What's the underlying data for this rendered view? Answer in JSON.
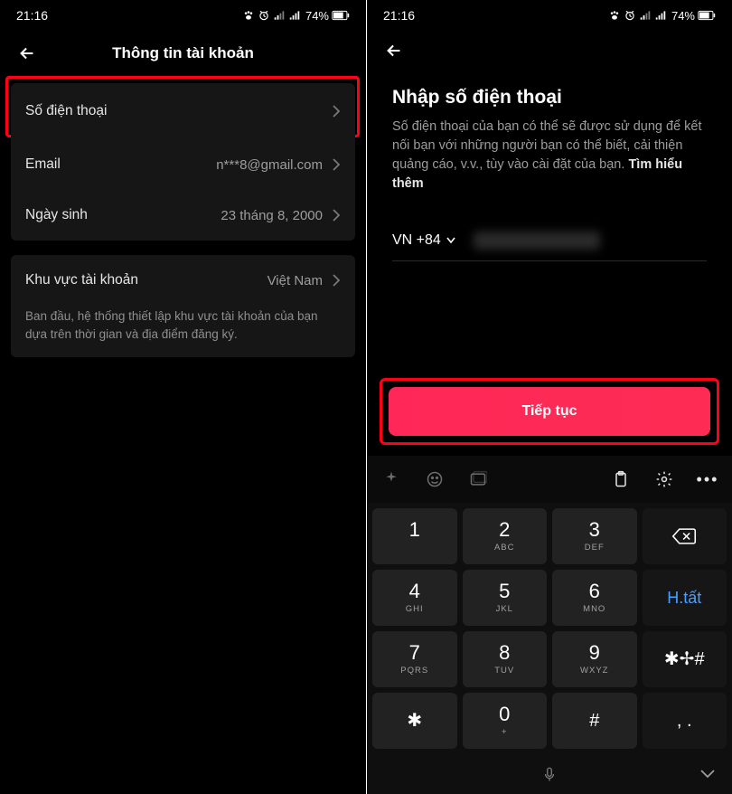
{
  "status": {
    "time": "21:16",
    "battery": "74%"
  },
  "left": {
    "headerTitle": "Thông tin tài khoản",
    "rows": {
      "phone": {
        "label": "Số điện thoại"
      },
      "email": {
        "label": "Email",
        "value": "n***8@gmail.com"
      },
      "dob": {
        "label": "Ngày sinh",
        "value": "23 tháng 8, 2000"
      }
    },
    "region": {
      "label": "Khu vực tài khoản",
      "value": "Việt Nam",
      "note": "Ban đầu, hệ thống thiết lập khu vực tài khoản của bạn dựa trên thời gian và địa điểm đăng ký."
    }
  },
  "right": {
    "title": "Nhập số điện thoại",
    "desc": "Số điện thoại của bạn có thể sẽ được sử dụng để kết nối bạn với những người bạn có thể biết, cải thiện quảng cáo, v.v., tùy vào cài đặt của bạn. ",
    "learnMore": "Tìm hiểu thêm",
    "countryCode": "VN +84",
    "cta": "Tiếp tục",
    "keyboard": {
      "keys": [
        [
          {
            "n": "1",
            "s": ""
          },
          {
            "n": "2",
            "s": "ABC"
          },
          {
            "n": "3",
            "s": "DEF"
          },
          {
            "icon": "backspace"
          }
        ],
        [
          {
            "n": "4",
            "s": "GHI"
          },
          {
            "n": "5",
            "s": "JKL"
          },
          {
            "n": "6",
            "s": "MNO"
          },
          {
            "label": "H.tất",
            "blue": true
          }
        ],
        [
          {
            "n": "7",
            "s": "PQRS"
          },
          {
            "n": "8",
            "s": "TUV"
          },
          {
            "n": "9",
            "s": "WXYZ"
          },
          {
            "label": "✱✢#"
          }
        ],
        [
          {
            "label": "✱"
          },
          {
            "n": "0",
            "s": "+"
          },
          {
            "label": "#"
          },
          {
            "label": ",  ."
          }
        ]
      ]
    }
  }
}
